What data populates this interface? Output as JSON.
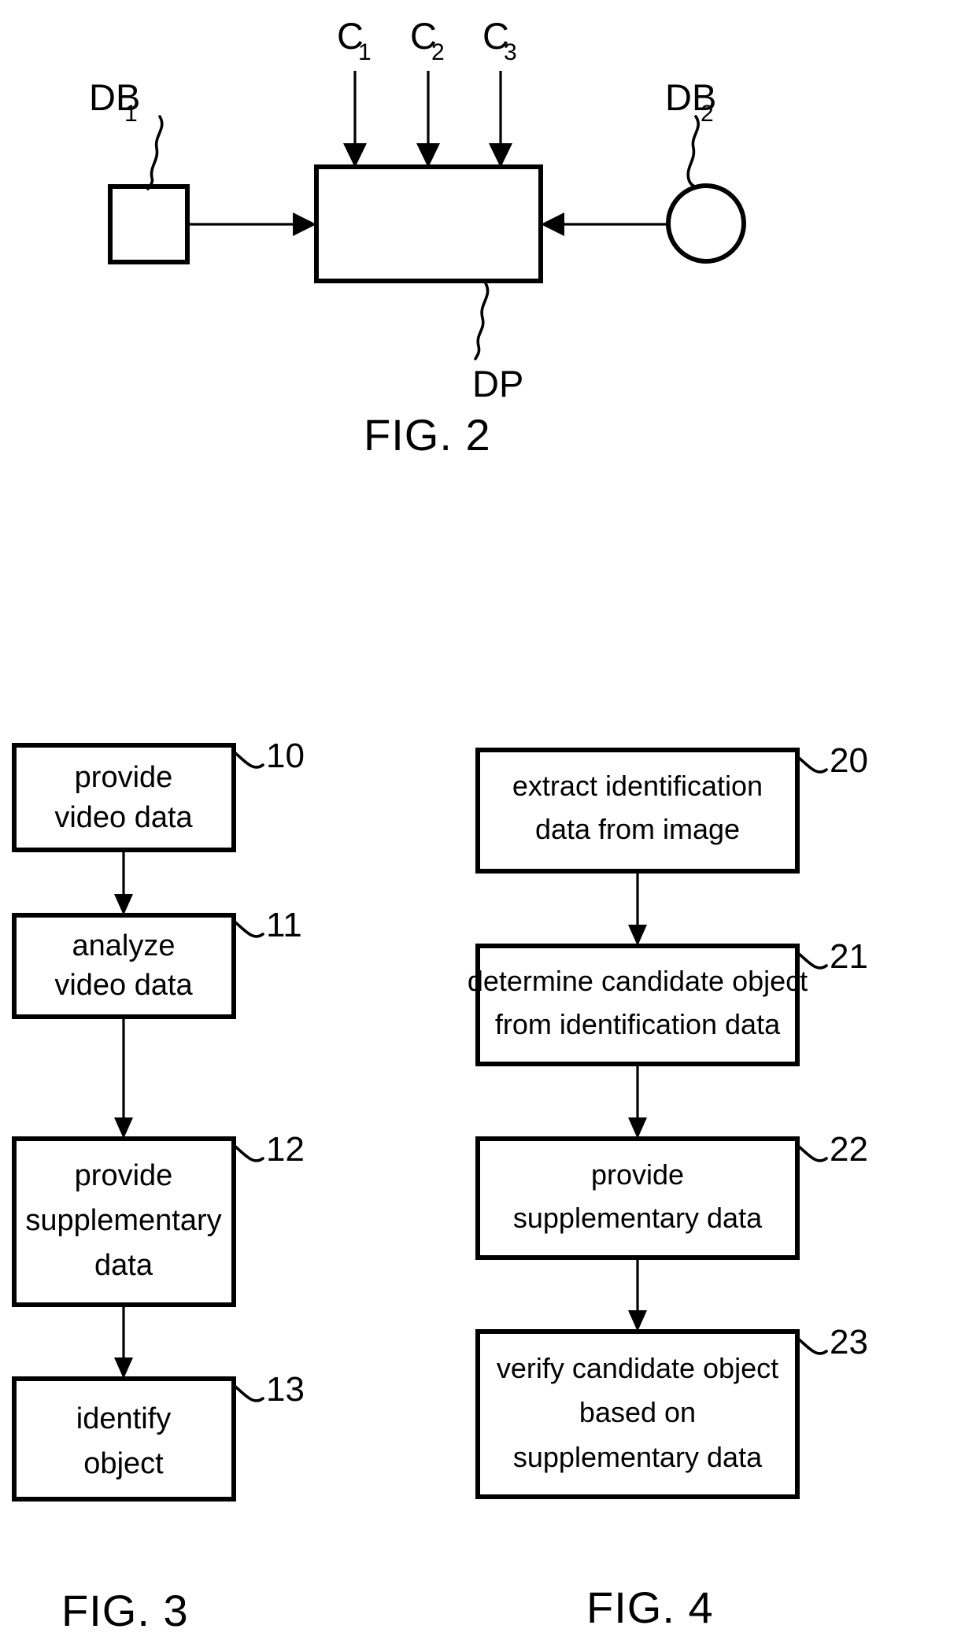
{
  "figures": [
    {
      "id": "fig2",
      "caption": "FIG. 2",
      "nodes": [
        {
          "name": "database-1",
          "label": "DB",
          "subscript": "1",
          "shape": "rectangle"
        },
        {
          "name": "data-processor",
          "label": "DP",
          "subscript": "",
          "shape": "rectangle"
        },
        {
          "name": "database-2",
          "label": "DB",
          "subscript": "2",
          "shape": "circle"
        }
      ],
      "inputs": [
        {
          "label": "C",
          "subscript": "1"
        },
        {
          "label": "C",
          "subscript": "2"
        },
        {
          "label": "C",
          "subscript": "3"
        }
      ]
    },
    {
      "id": "fig3",
      "caption": "FIG. 3",
      "steps": [
        {
          "ref": "10",
          "lines": [
            "provide",
            "video data"
          ]
        },
        {
          "ref": "11",
          "lines": [
            "analyze",
            "video data"
          ]
        },
        {
          "ref": "12",
          "lines": [
            "provide",
            "supplementary",
            "data"
          ]
        },
        {
          "ref": "13",
          "lines": [
            "identify",
            "object"
          ]
        }
      ]
    },
    {
      "id": "fig4",
      "caption": "FIG. 4",
      "steps": [
        {
          "ref": "20",
          "lines": [
            "extract identification",
            "data from image"
          ]
        },
        {
          "ref": "21",
          "lines": [
            "determine candidate object",
            "from identification data"
          ]
        },
        {
          "ref": "22",
          "lines": [
            "provide",
            "supplementary data"
          ]
        },
        {
          "ref": "23",
          "lines": [
            "verify candidate object",
            "based on",
            "supplementary data"
          ]
        }
      ]
    }
  ],
  "colors": {
    "ink": "#000000",
    "paper": "#ffffff"
  }
}
